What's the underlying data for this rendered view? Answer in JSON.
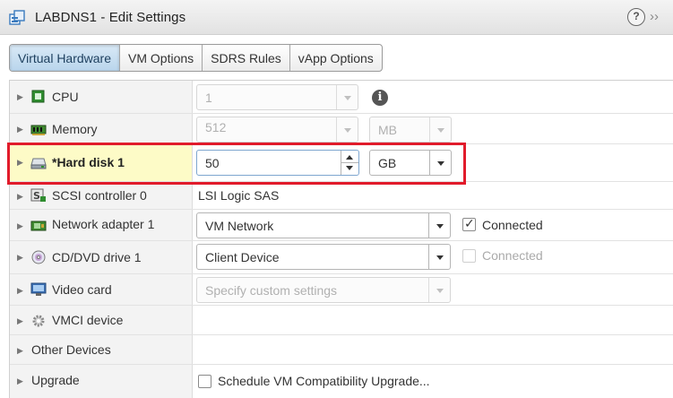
{
  "window": {
    "title": "LABDNS1 - Edit Settings",
    "help_label": "?",
    "expand_label": "››"
  },
  "tabs": [
    {
      "label": "Virtual Hardware",
      "active": true
    },
    {
      "label": "VM Options",
      "active": false
    },
    {
      "label": "SDRS Rules",
      "active": false
    },
    {
      "label": "vApp Options",
      "active": false
    }
  ],
  "rows": {
    "cpu": {
      "label": "CPU",
      "value": "1",
      "info": "i"
    },
    "memory": {
      "label": "Memory",
      "value": "512",
      "unit": "MB"
    },
    "hard_disk": {
      "label": "*Hard disk 1",
      "value": "50",
      "unit": "GB"
    },
    "scsi": {
      "label": "SCSI controller 0",
      "value": "LSI Logic SAS"
    },
    "network": {
      "label": "Network adapter 1",
      "value": "VM Network",
      "connected_label": "Connected",
      "connected": true
    },
    "cddvd": {
      "label": "CD/DVD drive 1",
      "value": "Client Device",
      "connected_label": "Connected",
      "connected": false
    },
    "video": {
      "label": "Video card",
      "value": "Specify custom settings"
    },
    "vmci": {
      "label": "VMCI device"
    },
    "other": {
      "label": "Other Devices"
    },
    "upgrade": {
      "label": "Upgrade",
      "checkbox_label": "Schedule VM Compatibility Upgrade..."
    }
  },
  "colors": {
    "highlight_row": "#fdfbc7",
    "annotation_box": "#e11b2b",
    "active_tab": "#c8def1"
  }
}
